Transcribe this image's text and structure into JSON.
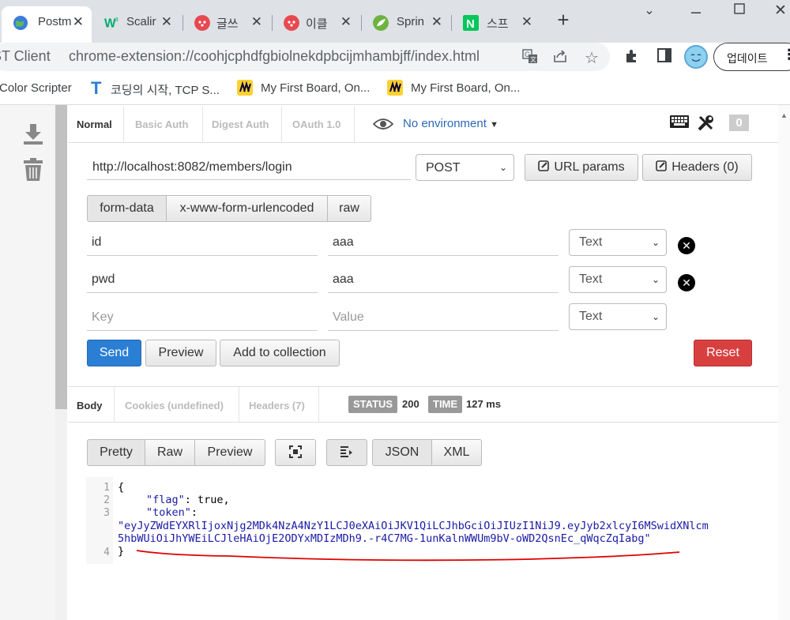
{
  "browser": {
    "tabs": [
      {
        "label": "Postm",
        "icon": "globe-icon",
        "color": "#3b7dd8"
      },
      {
        "label": "Scalir",
        "icon": "w3schools-icon",
        "color": "#04aa6d"
      },
      {
        "label": "글쓰",
        "icon": "fire-icon",
        "color": "#e8484f"
      },
      {
        "label": "이클",
        "icon": "fire-icon",
        "color": "#e8484f"
      },
      {
        "label": "Sprin",
        "icon": "spring-icon",
        "color": "#6db33f"
      },
      {
        "label": "스프",
        "icon": "naver-icon",
        "color": "#03c75a"
      }
    ],
    "omnibox_title": "ST Client",
    "url": "chrome-extension://coohjcphdfgbiolnekdpbcijmhambjff/index.html",
    "update_label": "업데이트",
    "bookmarks": [
      {
        "label": "Color Scripter"
      },
      {
        "label": "코딩의 시작, TCP S...",
        "icon": "tistory-icon"
      },
      {
        "label": "My First Board, On...",
        "icon": "miro-icon"
      },
      {
        "label": "My First Board, On...",
        "icon": "miro-icon"
      }
    ]
  },
  "auth_tabs": [
    "Normal",
    "Basic Auth",
    "Digest Auth",
    "OAuth 1.0"
  ],
  "environment": "No environment",
  "badge_count": "0",
  "request": {
    "url": "http://localhost:8082/members/login",
    "method": "POST",
    "url_params_label": "URL params",
    "headers_label": "Headers (0)",
    "body_modes": [
      "form-data",
      "x-www-form-urlencoded",
      "raw"
    ],
    "params": [
      {
        "key": "id",
        "value": "aaa",
        "type": "Text"
      },
      {
        "key": "pwd",
        "value": "aaa",
        "type": "Text"
      }
    ],
    "key_placeholder": "Key",
    "value_placeholder": "Value",
    "new_type": "Text",
    "send_label": "Send",
    "preview_label": "Preview",
    "add_collection_label": "Add to collection",
    "reset_label": "Reset"
  },
  "response": {
    "tabs": [
      "Body",
      "Cookies (undefined)",
      "Headers (7)"
    ],
    "status_label": "STATUS",
    "status": "200",
    "time_label": "TIME",
    "time": "127 ms",
    "view_modes": [
      "Pretty",
      "Raw",
      "Preview"
    ],
    "formats": [
      "JSON",
      "XML"
    ],
    "line_numbers": [
      "1",
      "2",
      "3",
      "4"
    ],
    "code": {
      "open": "{",
      "flag_key": "\"flag\"",
      "flag_val": "true,",
      "token_key": "\"token\"",
      "token_line1": "\"eyJyZWdEYXRlIjoxNjg2MDk4NzA4NzY1LCJ0eXAiOiJKV1QiLCJhbGciOiJIUzI1NiJ9.eyJyb2xlcyI6MSwidXNlcm",
      "token_line2": "5hbWUiOiJhYWEiLCJleHAiOjE2ODYxMDIzMDh9.-r4C7MG-1unKalnWWUm9bV-oWD2QsnEc_qWqcZqIabg\"",
      "close": "}"
    }
  }
}
